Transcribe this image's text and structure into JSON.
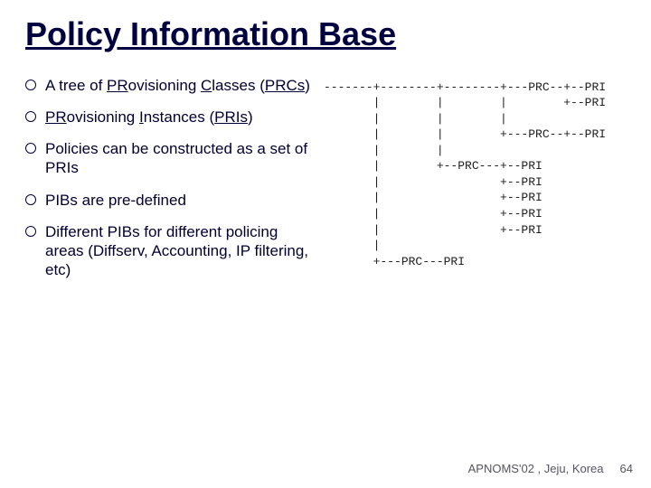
{
  "title": "Policy Information Base",
  "bullets": [
    {
      "pre": "A tree of ",
      "u1": "PR",
      "mid1": "ovisioning ",
      "u2": "C",
      "mid2": "lasses (",
      "u3": "PRCs",
      "post": ")"
    },
    {
      "u1": "PR",
      "mid1": "ovisioning ",
      "u2": "I",
      "mid2": "nstances (",
      "u3": "PRIs",
      "post": ")"
    },
    {
      "plain": "Policies can be constructed as a set of PRIs"
    },
    {
      "plain": "PIBs are pre-defined"
    },
    {
      "plain": "Different PIBs for different policing areas (Diffserv, Accounting, IP filtering, etc)"
    }
  ],
  "diagram": "-------+--------+--------+---PRC--+--PRI\n       |        |        |        +--PRI\n       |        |        |\n       |        |        +---PRC--+--PRI\n       |        |\n       |        +--PRC---+--PRI\n       |                 +--PRI\n       |                 +--PRI\n       |                 +--PRI\n       |                 +--PRI\n       |\n       +---PRC---PRI",
  "footer": {
    "venue": "APNOMS'02 , Jeju, Korea",
    "page": "64"
  }
}
